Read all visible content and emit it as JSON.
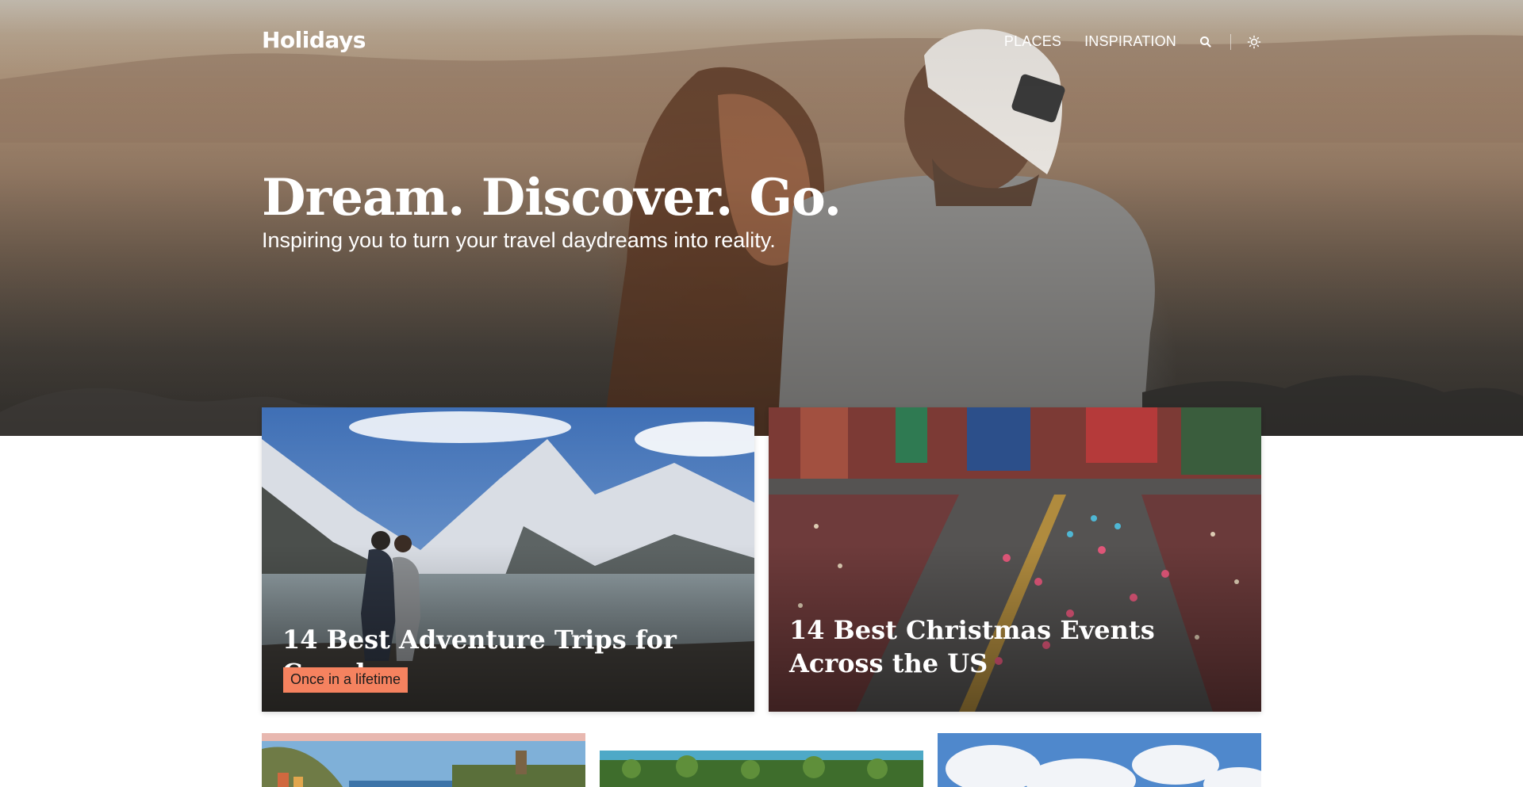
{
  "header": {
    "logo": "Holidays",
    "nav": [
      {
        "label": "PLACES"
      },
      {
        "label": "INSPIRATION"
      }
    ],
    "icons": [
      "search-icon",
      "theme-toggle-sun-icon"
    ]
  },
  "hero": {
    "title": "Dream. Discover. Go.",
    "subtitle": "Inspiring you to turn your travel daydreams into reality."
  },
  "featured": [
    {
      "title": "14 Best Adventure Trips for Couples",
      "badge": "Once in a lifetime"
    },
    {
      "title": "14 Best Christmas Events Across the US"
    }
  ],
  "colors": {
    "badge": "#f5825f",
    "text_light": "#ffffff"
  }
}
